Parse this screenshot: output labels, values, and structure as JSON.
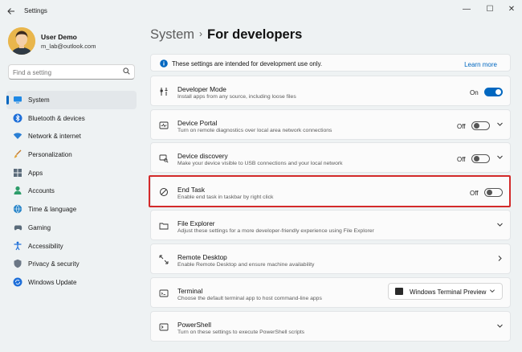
{
  "window": {
    "title": "Settings",
    "controls": {
      "minimize": "—",
      "maximize": "☐",
      "close": "✕"
    }
  },
  "user": {
    "name": "User Demo",
    "email": "m_lab@outlook.com"
  },
  "search": {
    "placeholder": "Find a setting"
  },
  "sidebar": {
    "items": [
      {
        "label": "System",
        "icon": "monitor-icon",
        "active": true
      },
      {
        "label": "Bluetooth & devices",
        "icon": "bluetooth-icon"
      },
      {
        "label": "Network & internet",
        "icon": "wifi-icon"
      },
      {
        "label": "Personalization",
        "icon": "brush-icon"
      },
      {
        "label": "Apps",
        "icon": "apps-icon"
      },
      {
        "label": "Accounts",
        "icon": "person-icon"
      },
      {
        "label": "Time & language",
        "icon": "globe-clock-icon"
      },
      {
        "label": "Gaming",
        "icon": "gamepad-icon"
      },
      {
        "label": "Accessibility",
        "icon": "accessibility-icon"
      },
      {
        "label": "Privacy & security",
        "icon": "shield-icon"
      },
      {
        "label": "Windows Update",
        "icon": "update-icon"
      }
    ]
  },
  "header": {
    "crumb": "System",
    "separator": "›",
    "current": "For developers"
  },
  "info": {
    "text": "These settings are intended for development use only.",
    "link": "Learn more"
  },
  "settings": [
    {
      "title": "Developer Mode",
      "desc": "Install apps from any source, including loose files",
      "state": "On",
      "on": true
    },
    {
      "title": "Device Portal",
      "desc": "Turn on remote diagnostics over local area network connections",
      "state": "Off",
      "on": false
    },
    {
      "title": "Device discovery",
      "desc": "Make your device visible to USB connections and your local network",
      "state": "Off",
      "on": false
    },
    {
      "title": "End Task",
      "desc": "Enable end task in taskbar by right click",
      "state": "Off",
      "on": false
    },
    {
      "title": "File Explorer",
      "desc": "Adjust these settings for a more developer-friendly experience using File Explorer"
    },
    {
      "title": "Remote Desktop",
      "desc": "Enable Remote Desktop and ensure machine availability"
    },
    {
      "title": "Terminal",
      "desc": "Choose the default terminal app to host command-line apps",
      "dropdown": "Windows Terminal Preview"
    },
    {
      "title": "PowerShell",
      "desc": "Turn on these settings to execute PowerShell scripts"
    }
  ],
  "colors": {
    "accent": "#0067c0",
    "highlight": "#d32a2a",
    "background": "#eef2f3",
    "card": "#fbfbfb"
  }
}
